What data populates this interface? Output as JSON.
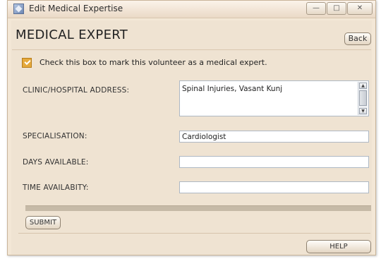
{
  "window": {
    "title": "Edit Medical Expertise",
    "minimize_symbol": "—",
    "maximize_symbol": "□",
    "close_symbol": "✕"
  },
  "header": {
    "title": "MEDICAL EXPERT",
    "back_label": "Back"
  },
  "medical_expert_checkbox": {
    "checked": true,
    "label": "Check this box to mark this volunteer as a medical expert."
  },
  "fields": {
    "clinic_address": {
      "label": "CLINIC/HOSPITAL ADDRESS:",
      "value": "Spinal Injuries, Vasant Kunj"
    },
    "specialisation": {
      "label": "SPECIALISATION:",
      "value": "Cardiologist"
    },
    "days_available": {
      "label": "DAYS AVAILABLE:",
      "value": ""
    },
    "time_availability": {
      "label": "TIME AVAILABITY:",
      "value": ""
    }
  },
  "actions": {
    "submit_label": "SUBMIT",
    "help_label": "HELP"
  },
  "colors": {
    "window_bg": "#f3e7d6",
    "checkbox_accent": "#e5a93c"
  }
}
